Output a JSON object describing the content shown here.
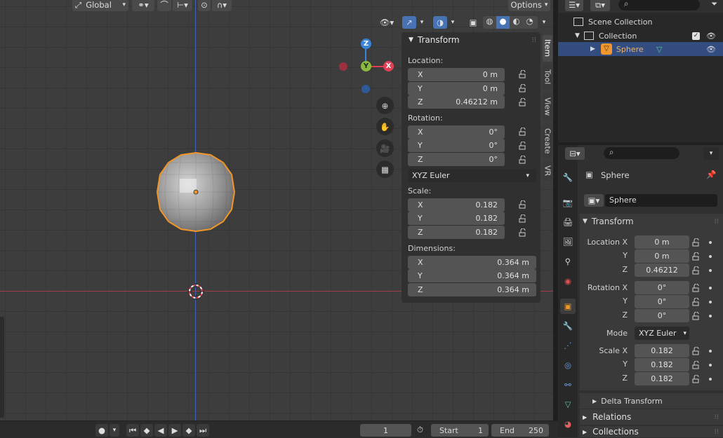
{
  "header": {
    "orientation": "Global",
    "options_label": "Options"
  },
  "npanel": {
    "title": "Transform",
    "location_label": "Location:",
    "location": [
      {
        "axis": "X",
        "value": "0 m"
      },
      {
        "axis": "Y",
        "value": "0 m"
      },
      {
        "axis": "Z",
        "value": "0.46212 m"
      }
    ],
    "rotation_label": "Rotation:",
    "rotation": [
      {
        "axis": "X",
        "value": "0°"
      },
      {
        "axis": "Y",
        "value": "0°"
      },
      {
        "axis": "Z",
        "value": "0°"
      }
    ],
    "rotation_mode": "XYZ Euler",
    "scale_label": "Scale:",
    "scale": [
      {
        "axis": "X",
        "value": "0.182"
      },
      {
        "axis": "Y",
        "value": "0.182"
      },
      {
        "axis": "Z",
        "value": "0.182"
      }
    ],
    "dimensions_label": "Dimensions:",
    "dimensions": [
      {
        "axis": "X",
        "value": "0.364 m"
      },
      {
        "axis": "Y",
        "value": "0.364 m"
      },
      {
        "axis": "Z",
        "value": "0.364 m"
      }
    ],
    "tabs": [
      "Item",
      "Tool",
      "View",
      "Create",
      "VR"
    ]
  },
  "gizmo": {
    "z": "Z",
    "y": "Y",
    "x": "X"
  },
  "outliner": {
    "scene_collection": "Scene Collection",
    "collection": "Collection",
    "object": "Sphere"
  },
  "properties": {
    "object_name": "Sphere",
    "data_name": "Sphere",
    "transform_title": "Transform",
    "location_x_label": "Location X",
    "y_label": "Y",
    "z_label": "Z",
    "location": [
      "0 m",
      "0 m",
      "0.46212"
    ],
    "rotation_x_label": "Rotation X",
    "rotation": [
      "0°",
      "0°",
      "0°"
    ],
    "mode_label": "Mode",
    "mode_value": "XYZ Euler",
    "scale_x_label": "Scale X",
    "scale": [
      "0.182",
      "0.182",
      "0.182"
    ],
    "delta_transform": "Delta Transform",
    "relations": "Relations",
    "collections": "Collections"
  },
  "timeline": {
    "current_frame": "1",
    "start_label": "Start",
    "start_value": "1",
    "end_label": "End",
    "end_value": "250"
  },
  "colors": {
    "accent": "#4772b3",
    "selected_outline": "#f0962a",
    "x_axis": "#e23e54",
    "y_axis": "#8bbb3d",
    "z_axis": "#3c84d9"
  }
}
